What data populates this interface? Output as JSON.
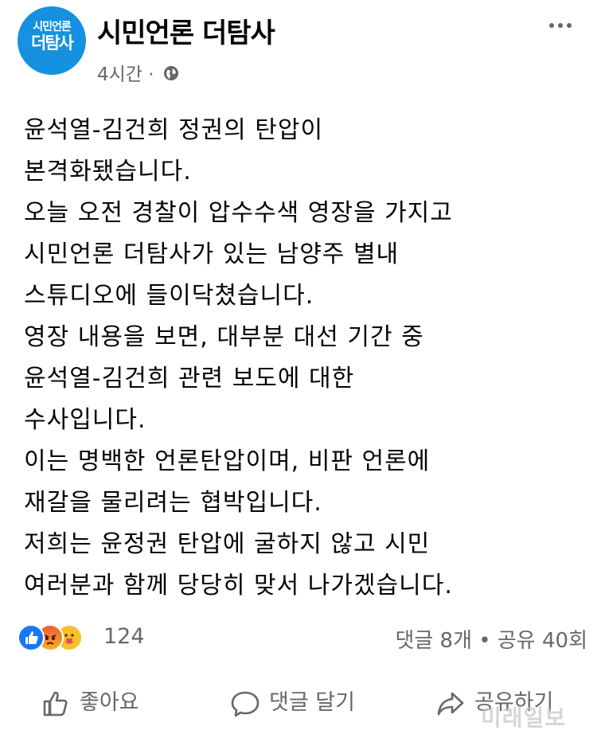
{
  "header": {
    "avatar_line1": "시민언론",
    "avatar_line2": "더탐사",
    "page_name": "시민언론 더탐사",
    "time": "4시간 ·"
  },
  "post": {
    "lines": [
      "윤석열-김건희 정권의 탄압이",
      "본격화됐습니다.",
      "오늘 오전 경찰이 압수수색 영장을 가지고",
      "시민언론 더탐사가 있는 남양주 별내",
      "스튜디오에 들이닥쳤습니다.",
      "영장 내용을 보면, 대부분 대선 기간 중",
      "윤석열-김건희 관련 보도에 대한",
      "수사입니다.",
      "이는 명백한 언론탄압이며, 비판 언론에",
      "재갈을 물리려는 협박입니다.",
      "저희는 윤정권 탄압에 굴하지 않고 시민",
      "여러분과 함께 당당히 맞서 나가겠습니다."
    ]
  },
  "reactions": {
    "count": "124",
    "icons": [
      "like-icon",
      "angry-icon",
      "care-icon"
    ]
  },
  "stats": {
    "text": "댓글 8개 • 공유 40회"
  },
  "actions": {
    "like": "좋아요",
    "comment": "댓글 달기",
    "share": "공유하기"
  },
  "watermark": "미래일보",
  "colors": {
    "facebook_blue": "#1877f2",
    "avatar_blue": "#1591e0",
    "secondary_text": "#65676b"
  }
}
